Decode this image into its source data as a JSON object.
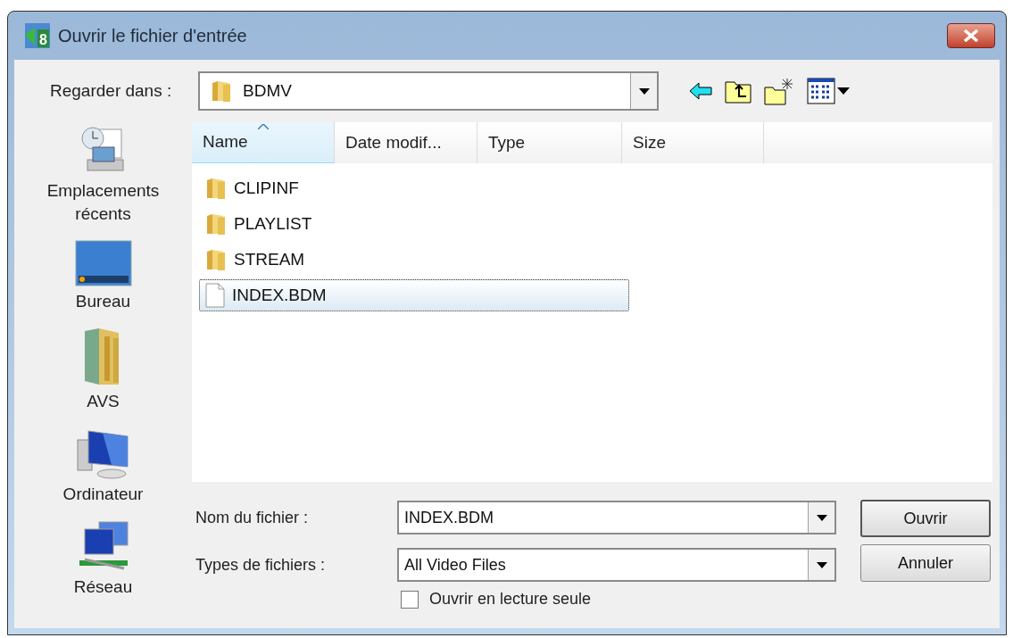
{
  "window": {
    "title": "Ouvrir le fichier d'entrée",
    "icon_text": "8"
  },
  "look_in": {
    "label": "Regarder dans :",
    "value": "BDMV"
  },
  "places": [
    {
      "label": "Emplacements récents"
    },
    {
      "label": "Bureau"
    },
    {
      "label": "AVS"
    },
    {
      "label": "Ordinateur"
    },
    {
      "label": "Réseau"
    }
  ],
  "file_list": {
    "columns": [
      {
        "label": "Name",
        "sorted": true
      },
      {
        "label": "Date modif...",
        "sorted": false
      },
      {
        "label": "Type",
        "sorted": false
      },
      {
        "label": "Size",
        "sorted": false
      }
    ],
    "rows": [
      {
        "name": "CLIPINF",
        "kind": "folder",
        "selected": false
      },
      {
        "name": "PLAYLIST",
        "kind": "folder",
        "selected": false
      },
      {
        "name": "STREAM",
        "kind": "folder",
        "selected": false
      },
      {
        "name": "INDEX.BDM",
        "kind": "file",
        "selected": true
      }
    ]
  },
  "file_name": {
    "label": "Nom du fichier :",
    "value": "INDEX.BDM"
  },
  "file_type": {
    "label": "Types de fichiers :",
    "value": "All Video Files"
  },
  "read_only": {
    "label": "Ouvrir en lecture seule",
    "checked": false
  },
  "buttons": [
    "Ouvrir",
    "Annuler"
  ]
}
